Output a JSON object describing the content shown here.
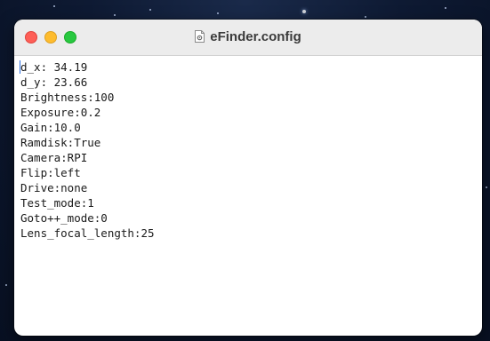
{
  "window": {
    "title": "eFinder.config",
    "title_icon": "document-gear-icon"
  },
  "traffic_lights": {
    "close_color": "#fe5f57",
    "minimize_color": "#febc2e",
    "zoom_color": "#28c840"
  },
  "editor": {
    "lines": [
      "d_x: 34.19",
      "d_y: 23.66",
      "Brightness:100",
      "Exposure:0.2",
      "Gain:10.0",
      "Ramdisk:True",
      "Camera:RPI",
      "Flip:left",
      "Drive:none",
      "Test_mode:1",
      "Goto++_mode:0",
      "Lens_focal_length:25"
    ]
  }
}
